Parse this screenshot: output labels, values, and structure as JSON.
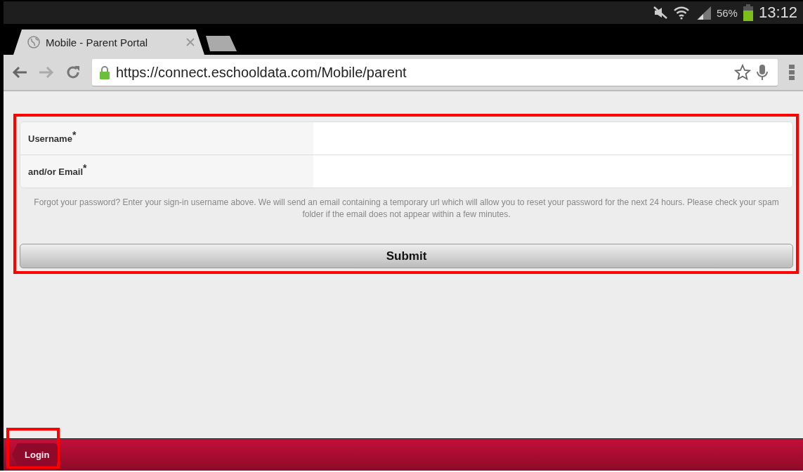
{
  "status_bar": {
    "battery": "56%",
    "time": "13:12"
  },
  "browser": {
    "tabs": [
      {
        "title": "Mobile - Parent Portal",
        "selected": true
      }
    ],
    "url": "https://connect.eschooldata.com/Mobile/parent"
  },
  "form": {
    "fields": [
      {
        "label": "Username$^{*}$"
      },
      {
        "label": "and/or Email$^{*}$"
      }
    ],
    "help_text": "Forgot your password? Enter your sign-in username above. We will send an email containing a temporary url which will allow you to reset your password for the next 24 hours. Please check your spam folder if the email does not appear within a few minutes.",
    "submit": "Submit"
  },
  "footer": {
    "back_button": "Login"
  }
}
